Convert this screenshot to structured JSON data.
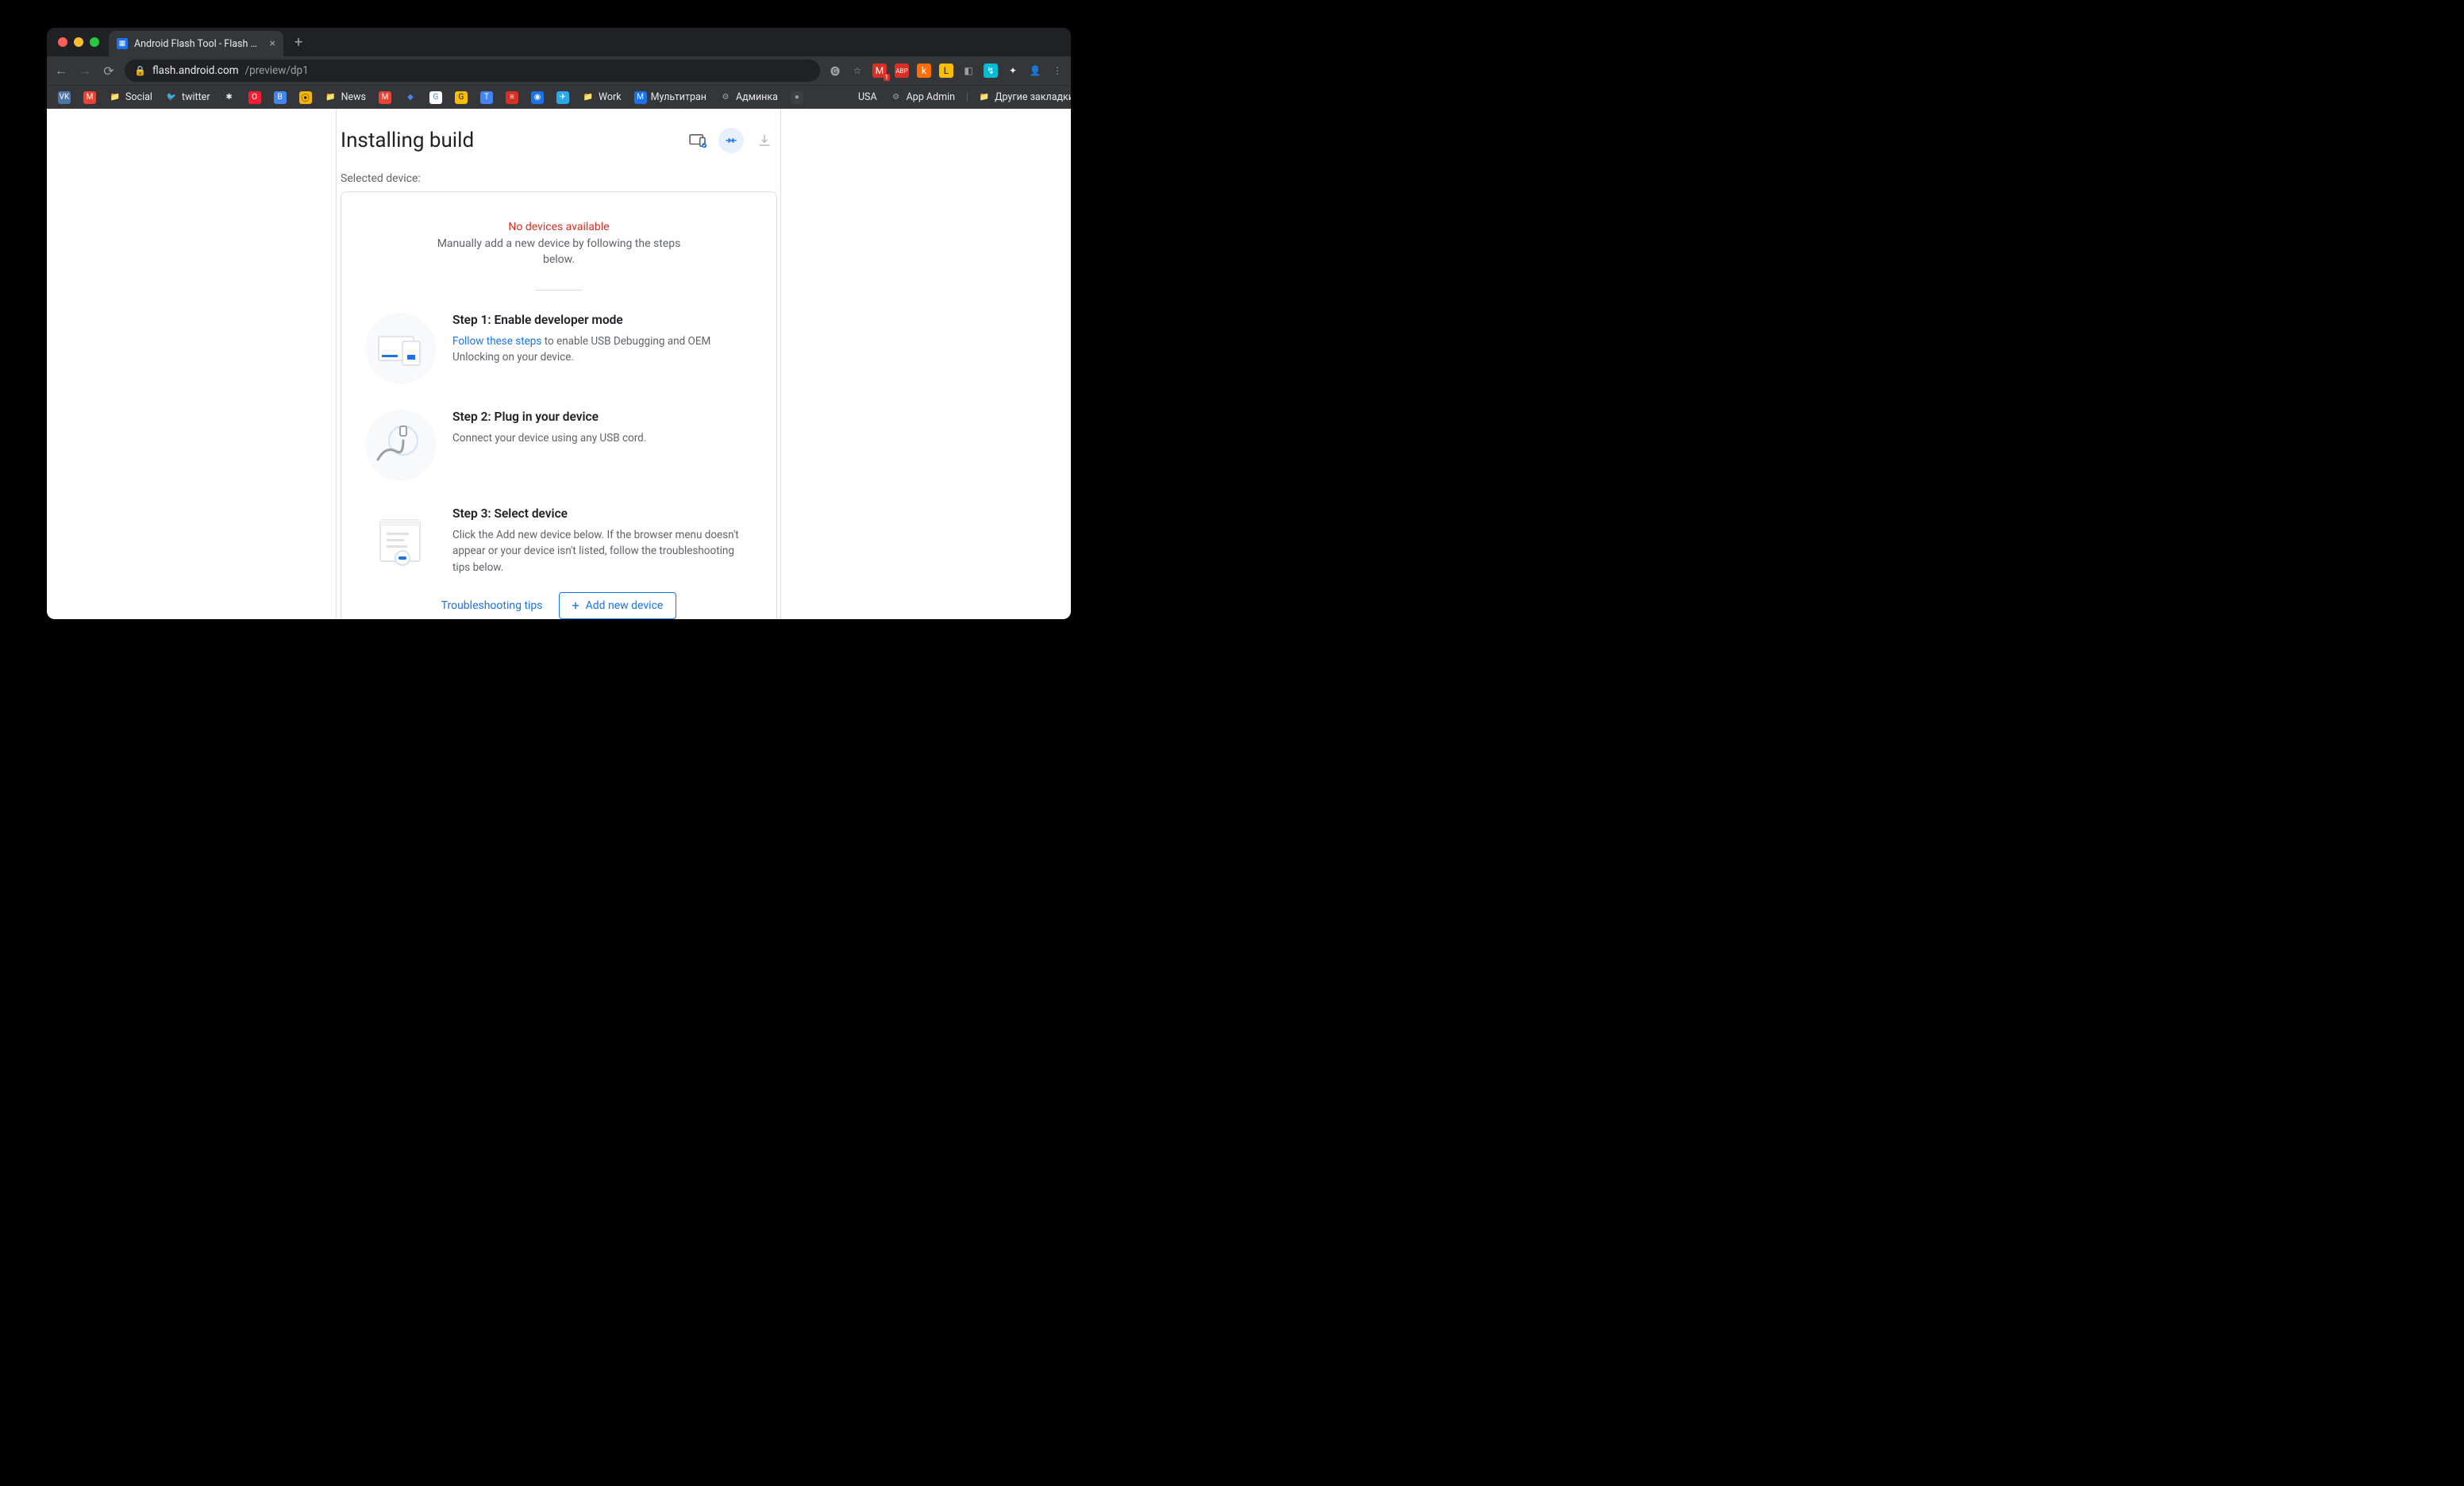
{
  "browser": {
    "tab_title": "Android Flash Tool - Flash Prev",
    "url_host": "flash.android.com",
    "url_path": "/preview/dp1",
    "extensions": {
      "translate": "GT",
      "star": "☆",
      "adblock_badge": "1",
      "abp": "ABP",
      "k": "k",
      "l": "L",
      "other1": "◧",
      "other2": "↯",
      "puzzle": "✦",
      "avatar": "👤"
    },
    "bookmarks": [
      {
        "label": "",
        "icon": "VK",
        "bg": "#4a76a8",
        "fg": "#fff"
      },
      {
        "label": "",
        "icon": "M",
        "bg": "#ea4335",
        "fg": "#fff"
      },
      {
        "label": "Social",
        "icon": "📁",
        "bg": "transparent"
      },
      {
        "label": "twitter",
        "icon": "🐦",
        "bg": "transparent",
        "fg": "#1da1f2"
      },
      {
        "label": "",
        "icon": "✱",
        "bg": "transparent"
      },
      {
        "label": "",
        "icon": "O",
        "bg": "#ff1b2d",
        "fg": "#fff"
      },
      {
        "label": "",
        "icon": "B",
        "bg": "#4285f4",
        "fg": "#fff"
      },
      {
        "label": "",
        "icon": "⦿",
        "bg": "#f4b400",
        "fg": "#202124"
      },
      {
        "label": "News",
        "icon": "📁",
        "bg": "transparent"
      },
      {
        "label": "",
        "icon": "M",
        "bg": "#ea4335",
        "fg": "#fff"
      },
      {
        "label": "",
        "icon": "◆",
        "bg": "transparent",
        "fg": "#4285f4"
      },
      {
        "label": "",
        "icon": "G",
        "bg": "#fff",
        "fg": "#4285f4"
      },
      {
        "label": "",
        "icon": "G",
        "bg": "#fbbc04",
        "fg": "#202124"
      },
      {
        "label": "",
        "icon": "T",
        "bg": "#4285f4",
        "fg": "#fff"
      },
      {
        "label": "",
        "icon": "≡",
        "bg": "#d93025",
        "fg": "#fff"
      },
      {
        "label": "",
        "icon": "◉",
        "bg": "#1a73e8",
        "fg": "#fff"
      },
      {
        "label": "",
        "icon": "✈",
        "bg": "#29a9ea",
        "fg": "#fff"
      },
      {
        "label": "Work",
        "icon": "📁",
        "bg": "transparent"
      },
      {
        "label": "Мультитран",
        "icon": "M",
        "bg": "#1a73e8",
        "fg": "#fff"
      },
      {
        "label": "Админка",
        "icon": "⚙",
        "bg": "transparent",
        "fg": "#9aa0a6"
      },
      {
        "label": "",
        "icon": "●",
        "bg": "#3c4043",
        "fg": "#9aa0a6"
      },
      {
        "label": "",
        "icon": "",
        "bg": "transparent",
        "fg": "#9aa0a6"
      },
      {
        "label": "USA",
        "icon": "",
        "bg": "transparent",
        "fg": "#9aa0a6"
      },
      {
        "label": "App Admin",
        "icon": "⚙",
        "bg": "transparent",
        "fg": "#9aa0a6"
      }
    ],
    "bookmarks_right": "Другие закладки"
  },
  "page": {
    "title": "Installing build",
    "selected_label": "Selected device:",
    "no_devices": "No devices available",
    "manual_text": "Manually add a new device by following the steps below.",
    "steps": [
      {
        "title": "Step 1: Enable developer mode",
        "link": "Follow these steps",
        "text_after_link": " to enable USB Debugging and OEM Unlocking on your device."
      },
      {
        "title": "Step 2: Plug in your device",
        "text": "Connect your device using any USB cord."
      },
      {
        "title": "Step 3: Select device",
        "text": "Click the Add new device below. If the browser menu doesn't appear or your device isn't listed, follow the troubleshooting tips below."
      }
    ],
    "troubleshoot_label": "Troubleshooting tips",
    "add_device_label": "Add new device"
  }
}
